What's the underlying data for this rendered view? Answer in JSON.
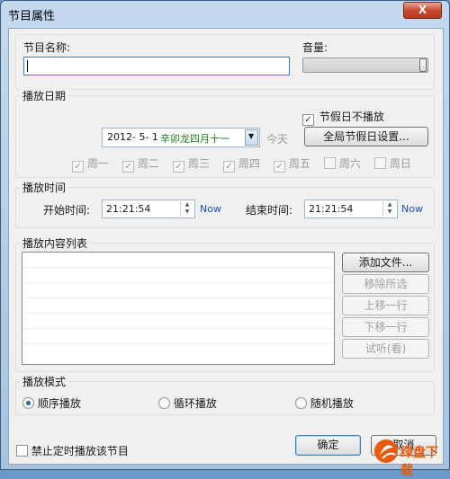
{
  "window": {
    "title": "节目属性",
    "close_symbol": "X"
  },
  "program": {
    "name_label": "节目名称:",
    "name_value": "",
    "volume_label": "音量:",
    "volume_level": 1.0
  },
  "play_date": {
    "group_label": "播放日期",
    "holiday_checkbox_label": "节假日不播放",
    "holiday_checked": true,
    "date_value": "2012- 5- 1",
    "lunar_text": "辛卯龙四月十一",
    "today_label": "今天",
    "global_holiday_button": "全局节假日设置...",
    "weekdays": [
      {
        "label": "周一",
        "checked": true
      },
      {
        "label": "周二",
        "checked": true
      },
      {
        "label": "周三",
        "checked": true
      },
      {
        "label": "周四",
        "checked": true
      },
      {
        "label": "周五",
        "checked": true
      },
      {
        "label": "周六",
        "checked": false
      },
      {
        "label": "周日",
        "checked": false
      }
    ]
  },
  "play_time": {
    "group_label": "播放时间",
    "start_label": "开始时间:",
    "start_value": "21:21:54",
    "end_label": "结束时间:",
    "end_value": "21:21:54",
    "now_label": "Now"
  },
  "content_list": {
    "group_label": "播放内容列表",
    "buttons": {
      "add": "添加文件...",
      "remove": "移除所选",
      "up": "上移一行",
      "down": "下移一行",
      "preview": "试听(看)"
    }
  },
  "play_mode": {
    "group_label": "播放模式",
    "options": [
      {
        "label": "顺序播放",
        "selected": true
      },
      {
        "label": "循环播放",
        "selected": false
      },
      {
        "label": "随机播放",
        "selected": false
      }
    ]
  },
  "footer": {
    "disable_timer_label": "禁止定时播放该节目",
    "ok_button": "确定",
    "cancel_button": "取消",
    "watermark_text": "绿盘下载"
  },
  "colors": {
    "lunar_text": "#1e7f1e",
    "now_link": "#1c4fb1",
    "close_button": "#c8482f",
    "watermark": "#e85a0c"
  }
}
